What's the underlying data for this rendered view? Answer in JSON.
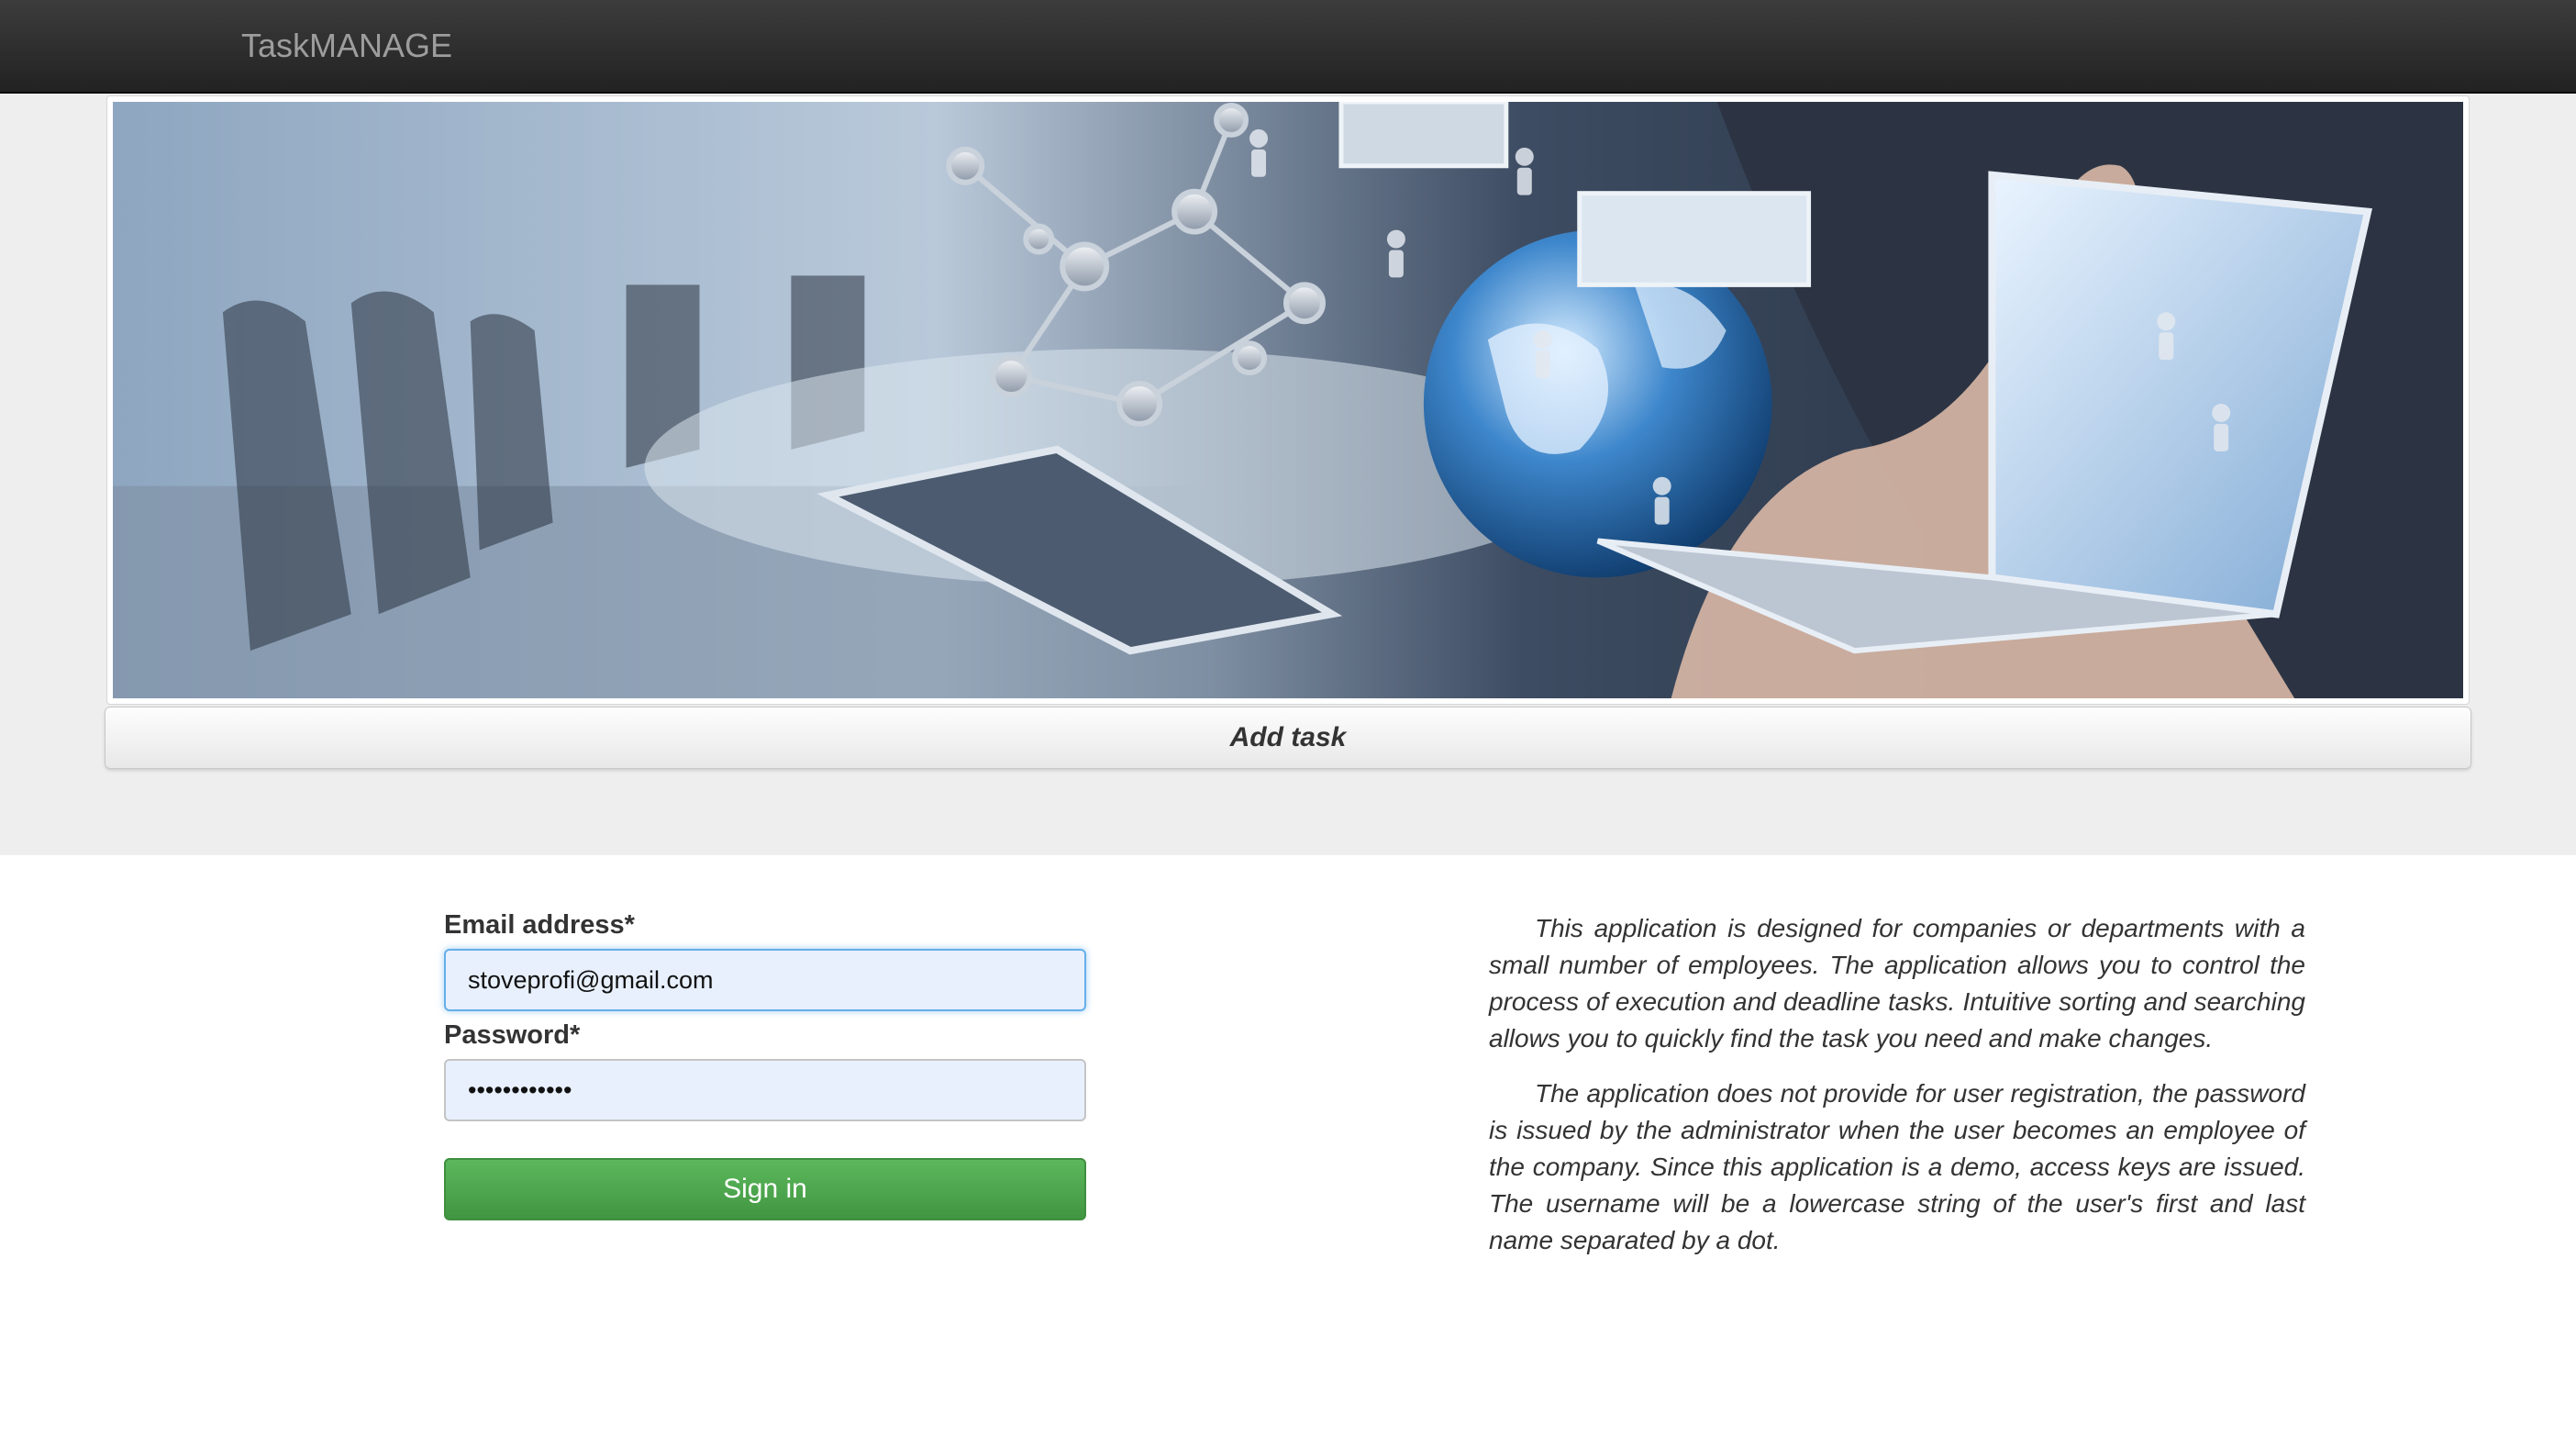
{
  "navbar": {
    "brand": "TaskMANAGE"
  },
  "hero": {
    "banner_image": "business-technology-globe-network-banner",
    "add_task_label": "Add task"
  },
  "login": {
    "email_label": "Email address*",
    "email_value": "stoveprofi@gmail.com",
    "password_label": "Password*",
    "password_value": "stoveprofi12",
    "signin_label": "Sign in"
  },
  "description": {
    "paragraph1": "This application is designed for companies or departments with a small number of employees. The application allows you to control the process of execution and deadline tasks. Intuitive sorting and searching allows you to quickly find the task you need and make changes.",
    "paragraph2": "The application does not provide for user registration, the password is issued by the administrator when the user becomes an employee of the company. Since this application is a demo, access keys are issued. The username will be a lowercase string of the user's first and last name separated by a dot."
  },
  "colors": {
    "navbar": "#222222",
    "hero_background": "#eeeeee",
    "signin_button": "#5cb85c",
    "input_autofill": "#e8f0fe"
  }
}
